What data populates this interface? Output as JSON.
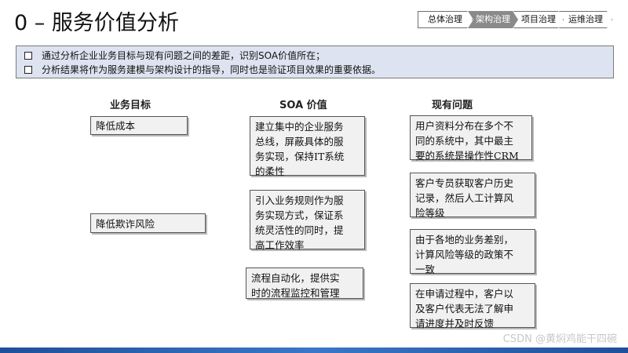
{
  "title": "0 – 服务价值分析",
  "breadcrumb": [
    "总体治理",
    "架构治理",
    "项目治理",
    "运维治理"
  ],
  "notes": [
    "通过分析企业业务目标与现有问题之间的差距，识别SOA价值所在；",
    "分析结果将作为服务建模与架构设计的指导，同时也是验证项目效果的重要依据。"
  ],
  "columns": {
    "business_goals": "业务目标",
    "soa_value": "SOA 价值",
    "existing_problems": "现有问题"
  },
  "business_goals": [
    "降低成本",
    "降低欺诈风险"
  ],
  "soa_values": [
    "建立集中的企业服务\n总线，屏蔽具体的服\n务实现，保持IT系统\n的柔性",
    "引入业务规则作为服\n务实现方式，保证系\n统灵活性的同时，提\n高工作效率",
    "流程自动化，提供实\n时的流程监控和管理"
  ],
  "problems": [
    "用户资料分布在多个不\n同的系统中，其中最主\n要的系统是操作性CRM",
    "客户专员获取客户历史\n记录，然后人工计算风\n险等级",
    "由于各地的业务差别，\n计算风险等级的政策不\n一致",
    "在申请过程中，客户以\n及客户代表无法了解申\n请进度并及时反馈"
  ],
  "watermark": "CSDN @黄焖鸡能干四碗"
}
